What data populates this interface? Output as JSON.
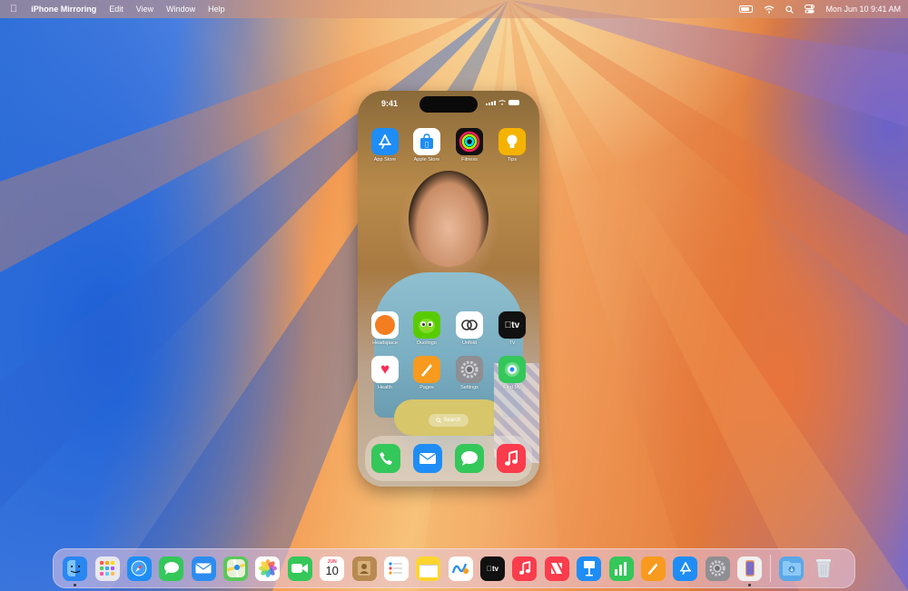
{
  "menubar": {
    "apple_icon": "apple-logo-icon",
    "app_name": "iPhone Mirroring",
    "menus": [
      "Edit",
      "View",
      "Window",
      "Help"
    ],
    "status_icons": [
      "battery-icon",
      "wifi-icon",
      "spotlight-search-icon",
      "control-center-icon"
    ],
    "datetime": "Mon Jun 10  9:41 AM"
  },
  "phone": {
    "time": "9:41",
    "top_apps": [
      {
        "label": "App Store",
        "icon": "app-store-icon",
        "color": "#1e8df5"
      },
      {
        "label": "Apple Store",
        "icon": "apple-store-bag-icon",
        "color": "#ffffff"
      },
      {
        "label": "Fitness",
        "icon": "fitness-rings-icon",
        "color": "#111111"
      },
      {
        "label": "Tips",
        "icon": "tips-lightbulb-icon",
        "color": "#f5b301"
      }
    ],
    "middle_apps": [
      {
        "label": "Headspace",
        "icon": "headspace-icon",
        "color": "#ffffff"
      },
      {
        "label": "Duolingo",
        "icon": "duolingo-icon",
        "color": "#58cc02"
      },
      {
        "label": "Unfold",
        "icon": "unfold-icon",
        "color": "#ffffff"
      },
      {
        "label": "TV",
        "icon": "apple-tv-icon",
        "color": "#111111"
      }
    ],
    "bottom_apps": [
      {
        "label": "Health",
        "icon": "health-heart-icon",
        "color": "#ffffff"
      },
      {
        "label": "Pages",
        "icon": "pages-icon",
        "color": "#f79a1e"
      },
      {
        "label": "Settings",
        "icon": "settings-gear-icon",
        "color": "#8e8e93"
      },
      {
        "label": "Find My",
        "icon": "find-my-icon",
        "color": "#34c759"
      }
    ],
    "search_label": "Search",
    "dock_apps": [
      {
        "icon": "phone-icon",
        "color": "#34c759"
      },
      {
        "icon": "mail-icon",
        "color": "#1e8df5"
      },
      {
        "icon": "messages-icon",
        "color": "#34c759"
      },
      {
        "icon": "music-icon",
        "color": "#fa3c4c"
      }
    ]
  },
  "dock": {
    "calendar_month": "JUN",
    "calendar_day": "10",
    "apps": [
      {
        "name": "finder-icon",
        "color": "#2a86f0"
      },
      {
        "name": "launchpad-icon",
        "color": "#e8e8ee"
      },
      {
        "name": "safari-icon",
        "color": "#1e8df5"
      },
      {
        "name": "messages-icon",
        "color": "#34c759"
      },
      {
        "name": "mail-icon",
        "color": "#2d8cf0"
      },
      {
        "name": "maps-icon",
        "color": "#5ac85a"
      },
      {
        "name": "photos-icon",
        "color": "#ffffff"
      },
      {
        "name": "facetime-icon",
        "color": "#34c759"
      },
      {
        "name": "calendar-icon",
        "color": "#ffffff"
      },
      {
        "name": "contacts-icon",
        "color": "#b88950"
      },
      {
        "name": "reminders-icon",
        "color": "#ffffff"
      },
      {
        "name": "notes-icon",
        "color": "#ffd52e"
      },
      {
        "name": "freeform-icon",
        "color": "#ffffff"
      },
      {
        "name": "apple-tv-icon",
        "color": "#111111"
      },
      {
        "name": "music-icon",
        "color": "#fa3c4c"
      },
      {
        "name": "news-icon",
        "color": "#fa3c4c"
      },
      {
        "name": "keynote-icon",
        "color": "#1e8df5"
      },
      {
        "name": "numbers-icon",
        "color": "#34c759"
      },
      {
        "name": "pages-icon",
        "color": "#f79a1e"
      },
      {
        "name": "app-store-icon",
        "color": "#1e8df5"
      },
      {
        "name": "system-settings-icon",
        "color": "#8e8e93"
      },
      {
        "name": "iphone-mirroring-icon",
        "color": "#f0f0f0"
      }
    ],
    "after_separator": [
      {
        "name": "downloads-folder-icon",
        "color": "#5aa8e8"
      },
      {
        "name": "trash-icon",
        "color": "#d8dde4"
      }
    ]
  }
}
